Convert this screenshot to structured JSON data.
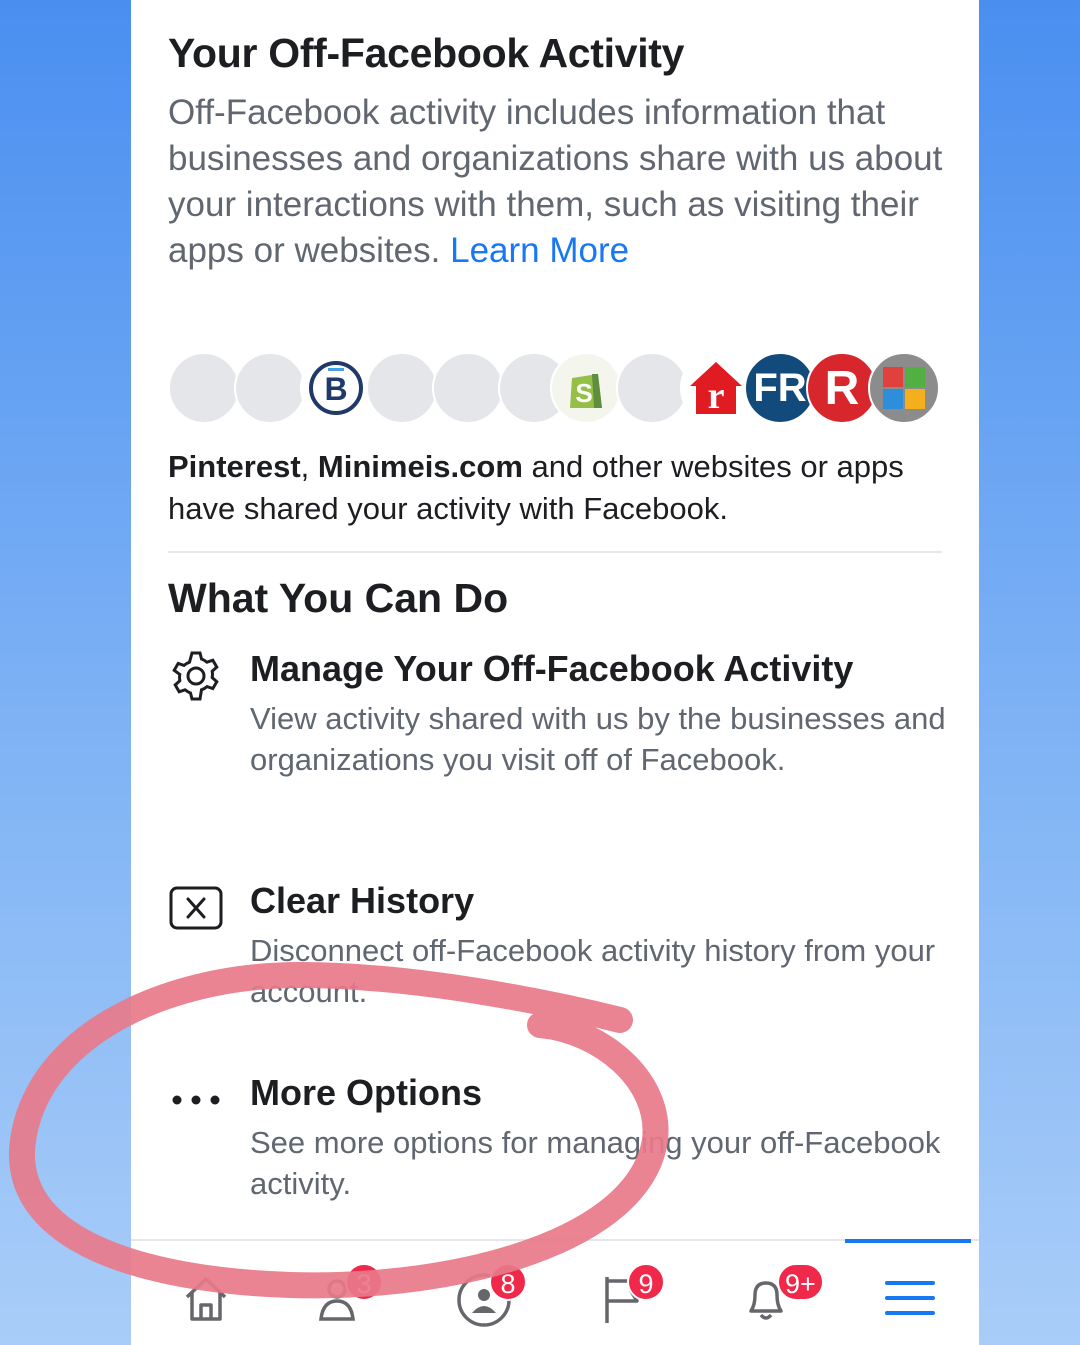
{
  "header": {
    "title": "Your Off-Facebook Activity",
    "description": "Off-Facebook activity includes information that businesses and organizations share with us about your interactions with them, such as visiting their apps or websites.",
    "learn_more": "Learn More"
  },
  "app_icons": [
    {
      "name": "blank-app-icon",
      "label": ""
    },
    {
      "name": "blank-app-icon",
      "label": ""
    },
    {
      "name": "b-logo-icon",
      "label": "B"
    },
    {
      "name": "blank-app-icon",
      "label": ""
    },
    {
      "name": "blank-app-icon",
      "label": ""
    },
    {
      "name": "blank-app-icon",
      "label": ""
    },
    {
      "name": "shopify-logo-icon",
      "label": "S"
    },
    {
      "name": "blank-app-icon",
      "label": ""
    },
    {
      "name": "realtor-logo-icon",
      "label": "r"
    },
    {
      "name": "fr-logo-icon",
      "label": "FR"
    },
    {
      "name": "r-logo-icon",
      "label": "R"
    },
    {
      "name": "grid-logo-icon",
      "label": ""
    }
  ],
  "shared": {
    "bold1": "Pinterest",
    "sep": ", ",
    "bold2": "Minimeis.com",
    "rest": " and other websites or apps have shared your activity with Facebook."
  },
  "section_title": "What You Can Do",
  "options": {
    "manage": {
      "title": "Manage Your Off-Facebook Activity",
      "description": "View activity shared with us by the businesses and organizations you visit off of Facebook."
    },
    "clear": {
      "title": "Clear History",
      "description": "Disconnect off-Facebook activity history from your account."
    },
    "more": {
      "title": "More Options",
      "description": "See more options for managing your off-Facebook activity."
    }
  },
  "tabbar": {
    "friends_badge": "3",
    "groups_badge": "8",
    "pages_badge": "9",
    "notifications_badge": "9+"
  },
  "colors": {
    "accent": "#1877f2",
    "badge": "#f02849",
    "annotation": "#e8798a"
  }
}
